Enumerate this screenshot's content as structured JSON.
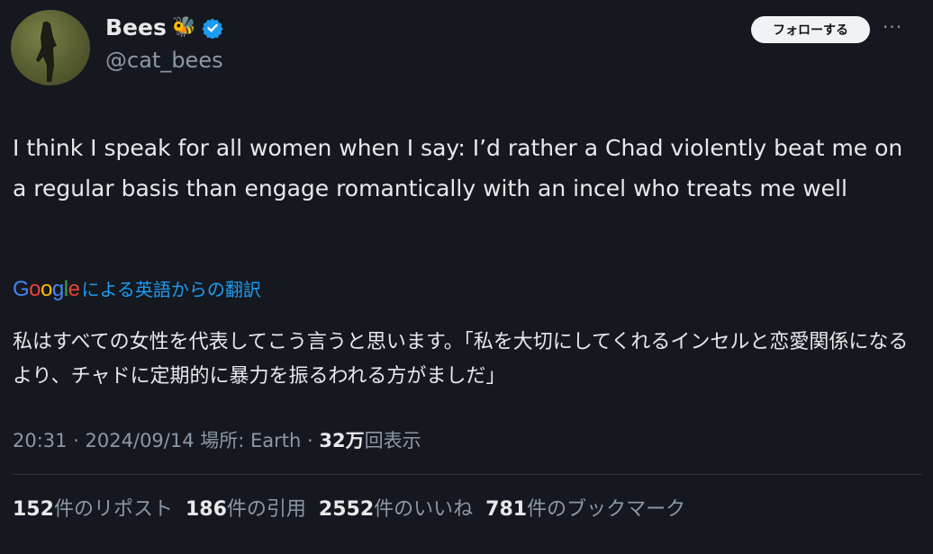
{
  "author": {
    "display_name": "Bees",
    "emoji": "🐝",
    "handle": "@cat_bees",
    "verified": true,
    "accent_color": "#1d9bf0"
  },
  "follow_button_label": "フォローする",
  "more_label": "···",
  "tweet_text": "I think I speak for all women when I say: I’d rather a Chad violently beat me on a regular basis than engage romantically with an incel who treats me well",
  "translation": {
    "provider": "Google",
    "source_label": "による英語からの翻訳",
    "text": "私はすべての女性を代表してこう言うと思います。「私を大切にしてくれるインセルと恋愛関係になるより、チャドに定期的に暴力を振るわれる方がましだ」"
  },
  "meta": {
    "time_prefix": "20:31 · 2024/09/14 場所: Earth · ",
    "views_count": "32万",
    "views_label": "回表示"
  },
  "stats": {
    "reposts_count": "152",
    "reposts_label": "件のリポスト",
    "quotes_count": "186",
    "quotes_label": "件の引用",
    "likes_count": "2552",
    "likes_label": "件のいいね",
    "bookmarks_count": "781",
    "bookmarks_label": "件のブックマーク"
  }
}
